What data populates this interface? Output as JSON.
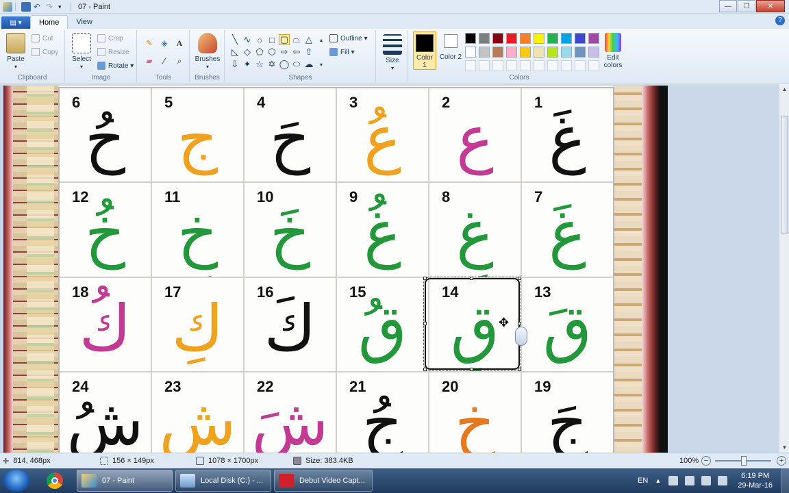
{
  "window": {
    "title": "07 - Paint",
    "controls": {
      "minimize": "—",
      "maximize": "❐",
      "close": "✕"
    }
  },
  "ribbon_tabs": {
    "app_menu": "▤ ▾",
    "home": "Home",
    "view": "View"
  },
  "clipboard": {
    "label": "Clipboard",
    "paste": "Paste",
    "cut": "Cut",
    "copy": "Copy"
  },
  "image": {
    "label": "Image",
    "select": "Select",
    "crop": "Crop",
    "resize": "Resize",
    "rotate": "Rotate"
  },
  "tools": {
    "label": "Tools"
  },
  "brushes": {
    "label": "Brushes"
  },
  "shapes": {
    "label": "Shapes",
    "outline": "Outline",
    "fill": "Fill"
  },
  "size": {
    "label": "Size"
  },
  "colors": {
    "label": "Colors",
    "color1": "Color 1",
    "color2": "Color 2",
    "edit": "Edit colors",
    "color1_value": "#000000",
    "color2_value": "#ffffff",
    "palette_row1": [
      "#000000",
      "#7f7f7f",
      "#880015",
      "#ed1c24",
      "#ff7f27",
      "#fff200",
      "#22b14c",
      "#00a2e8",
      "#3f48cc",
      "#a349a4"
    ],
    "palette_row2": [
      "#ffffff",
      "#c3c3c3",
      "#b97a57",
      "#ffaec9",
      "#ffc90e",
      "#efe4b0",
      "#b5e61d",
      "#99d9ea",
      "#7092be",
      "#c8bfe7"
    ]
  },
  "canvas": {
    "cells": [
      {
        "n": "1",
        "letter": "غَ",
        "color": "#111111"
      },
      {
        "n": "2",
        "letter": "ع",
        "color": "#c23a93"
      },
      {
        "n": "3",
        "letter": "عُ",
        "color": "#f0a21e"
      },
      {
        "n": "4",
        "letter": "حَ",
        "color": "#111111"
      },
      {
        "n": "5",
        "letter": "جِ",
        "color": "#f0a21e"
      },
      {
        "n": "6",
        "letter": "حُ",
        "color": "#111111"
      },
      {
        "n": "7",
        "letter": "غَ",
        "color": "#22983a"
      },
      {
        "n": "8",
        "letter": "غِ",
        "color": "#22983a"
      },
      {
        "n": "9",
        "letter": "غُ",
        "color": "#22983a"
      },
      {
        "n": "10",
        "letter": "خَ",
        "color": "#22983a"
      },
      {
        "n": "11",
        "letter": "خِ",
        "color": "#22983a"
      },
      {
        "n": "12",
        "letter": "خُ",
        "color": "#22983a"
      },
      {
        "n": "13",
        "letter": "قَ",
        "color": "#22983a"
      },
      {
        "n": "14",
        "letter": "قِ",
        "color": "#22983a"
      },
      {
        "n": "15",
        "letter": "قُ",
        "color": "#22983a"
      },
      {
        "n": "16",
        "letter": "كَ",
        "color": "#111111"
      },
      {
        "n": "17",
        "letter": "كِ",
        "color": "#f0a21e"
      },
      {
        "n": "18",
        "letter": "كُ",
        "color": "#c23a93"
      },
      {
        "n": "19",
        "letter": "جَ",
        "color": "#111111"
      },
      {
        "n": "20",
        "letter": "خِ",
        "color": "#e8781e"
      },
      {
        "n": "21",
        "letter": "جُ",
        "color": "#111111"
      },
      {
        "n": "22",
        "letter": "شَ",
        "color": "#c23a93"
      },
      {
        "n": "23",
        "letter": "شِ",
        "color": "#f0a21e"
      },
      {
        "n": "24",
        "letter": "شُ",
        "color": "#111111"
      }
    ]
  },
  "status": {
    "cursor": "814, 468px",
    "selection": "156 × 149px",
    "image_size": "1078 × 1700px",
    "file_size": "Size: 383.4KB",
    "zoom": "100%"
  },
  "taskbar": {
    "paint": "07 - Paint",
    "explorer": "Local Disk (C:) - ...",
    "debut": "Debut Video Capt...",
    "lang": "EN",
    "time": "6:19 PM",
    "date": "29-Mar-16"
  }
}
